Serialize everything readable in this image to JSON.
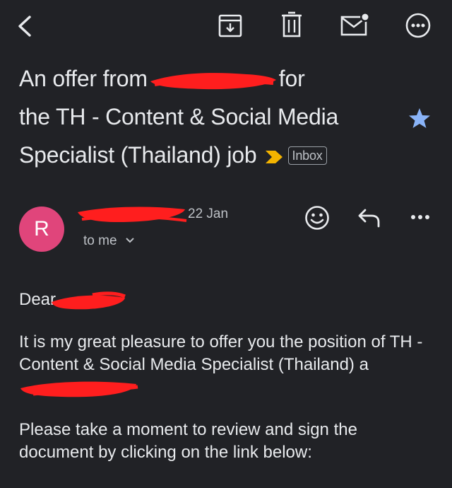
{
  "toolbar": {
    "back_icon": "arrow-back-icon",
    "archive_icon": "archive-icon",
    "delete_icon": "trash-icon",
    "mark_unread_icon": "mail-unread-icon",
    "more_icon": "more-horizontal-icon"
  },
  "subject": {
    "line1_start": "An offer from",
    "line1_end": "for",
    "line2": "the TH - Content & Social Media",
    "line3": "Specialist (Thailand) job",
    "label": "Inbox",
    "starred": true,
    "important_color": "#f4b400",
    "star_color": "#8ab4f8"
  },
  "sender": {
    "avatar_letter": "R",
    "avatar_color": "#e0457b",
    "date": "22 Jan",
    "recipient": "to me"
  },
  "body": {
    "greeting": "Dear",
    "para1_start": "It is my great pleasure to offer you the position of TH - Content & Social Media Specialist (Thailand) a",
    "para2": "Please take a moment to review and sign the document by clicking on the link below:"
  },
  "redaction_color": "#ff1e1e"
}
